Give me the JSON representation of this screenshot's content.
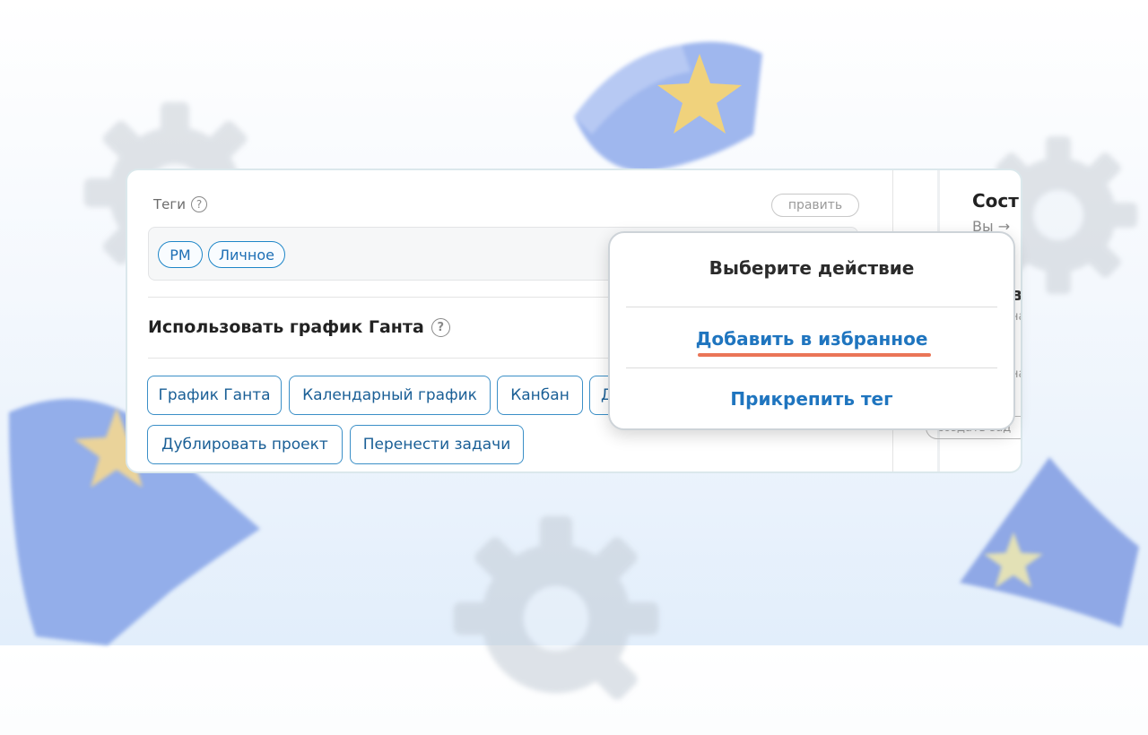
{
  "card": {
    "tags_label": "Теги",
    "help_glyph": "?",
    "edit_label": "править",
    "tags": [
      "PM",
      "Личное"
    ],
    "gantt_title": "Использовать график Ганта",
    "actions_row1": [
      "График Ганта",
      "Календарный график",
      "Канбан",
      "Д"
    ],
    "actions_row2": [
      "Дублировать проект",
      "Перенести задачи"
    ]
  },
  "side": {
    "title": "Сост",
    "subtitle": "Вы →",
    "frag1": "в",
    "frag2": "на",
    "frag3": "на",
    "input_placeholder": "создать зад"
  },
  "popup": {
    "title": "Выберите действие",
    "items": [
      "Добавить в избранное",
      "Прикрепить тег"
    ],
    "accent_color": "#1f75bf",
    "underline_color": "#ea7557"
  },
  "icons": [
    "help-icon",
    "arrow-right-icon",
    "gear-icon",
    "star-icon",
    "flag-icon"
  ]
}
